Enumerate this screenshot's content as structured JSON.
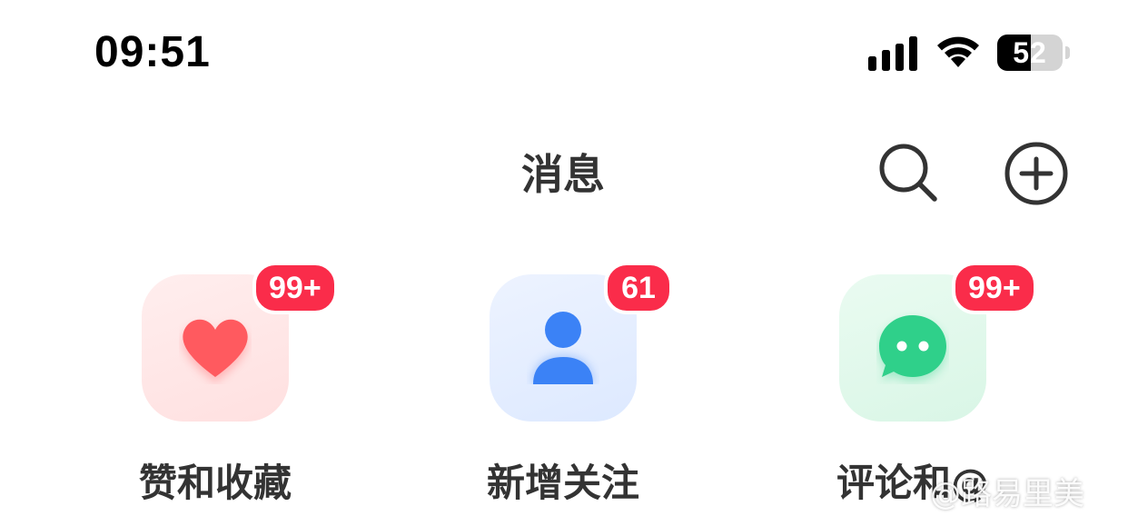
{
  "status_bar": {
    "time": "09:51",
    "battery_level": "52",
    "battery_fraction": 0.52
  },
  "header": {
    "title": "消息",
    "search_icon": "search-icon",
    "add_icon": "plus-circle-icon"
  },
  "shortcuts": [
    {
      "label": "赞和收藏",
      "badge": "99+",
      "icon": "heart-icon",
      "color": "#ff5a5f"
    },
    {
      "label": "新增关注",
      "badge": "61",
      "icon": "person-icon",
      "color": "#3b82f6"
    },
    {
      "label": "评论和@",
      "badge": "99+",
      "icon": "chat-bubble-icon",
      "color": "#2fd08a"
    }
  ],
  "colors": {
    "badge": "#fa2c4a",
    "text": "#333333"
  },
  "watermark": "@路易里美"
}
